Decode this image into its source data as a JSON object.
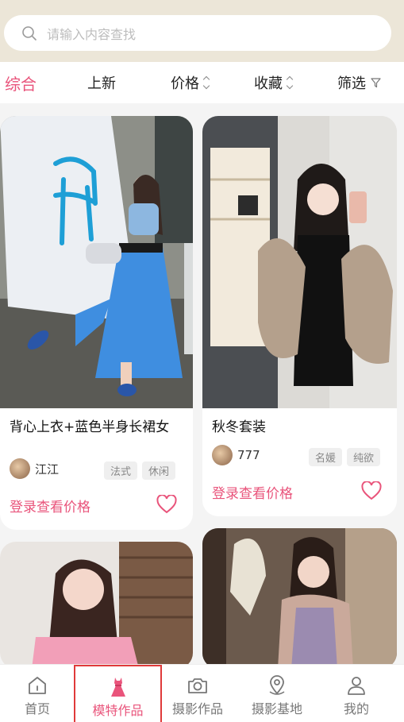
{
  "search": {
    "placeholder": "请输入内容查找"
  },
  "sort": {
    "comprehensive": "综合",
    "newest": "上新",
    "price": "价格",
    "favorites": "收藏",
    "filter": "筛选"
  },
  "cards": [
    {
      "title": "背心上衣+蓝色半身长裙女",
      "author": "江江",
      "tags": [
        "法式",
        "休闲"
      ],
      "price_label": "登录查看价格"
    },
    {
      "title": "秋冬套装",
      "author": "777",
      "tags": [
        "名媛",
        "纯欲"
      ],
      "price_label": "登录查看价格"
    },
    {
      "title": "",
      "author": "",
      "tags": [],
      "price_label": ""
    },
    {
      "title": "",
      "author": "",
      "tags": [],
      "price_label": ""
    }
  ],
  "tabs": [
    {
      "label": "首页",
      "icon": "home-icon"
    },
    {
      "label": "模特作品",
      "icon": "dress-icon",
      "active": true
    },
    {
      "label": "摄影作品",
      "icon": "camera-icon"
    },
    {
      "label": "摄影基地",
      "icon": "location-icon"
    },
    {
      "label": "我的",
      "icon": "user-icon"
    }
  ],
  "colors": {
    "accent": "#e9547b",
    "header_bg": "#ece6d8"
  }
}
